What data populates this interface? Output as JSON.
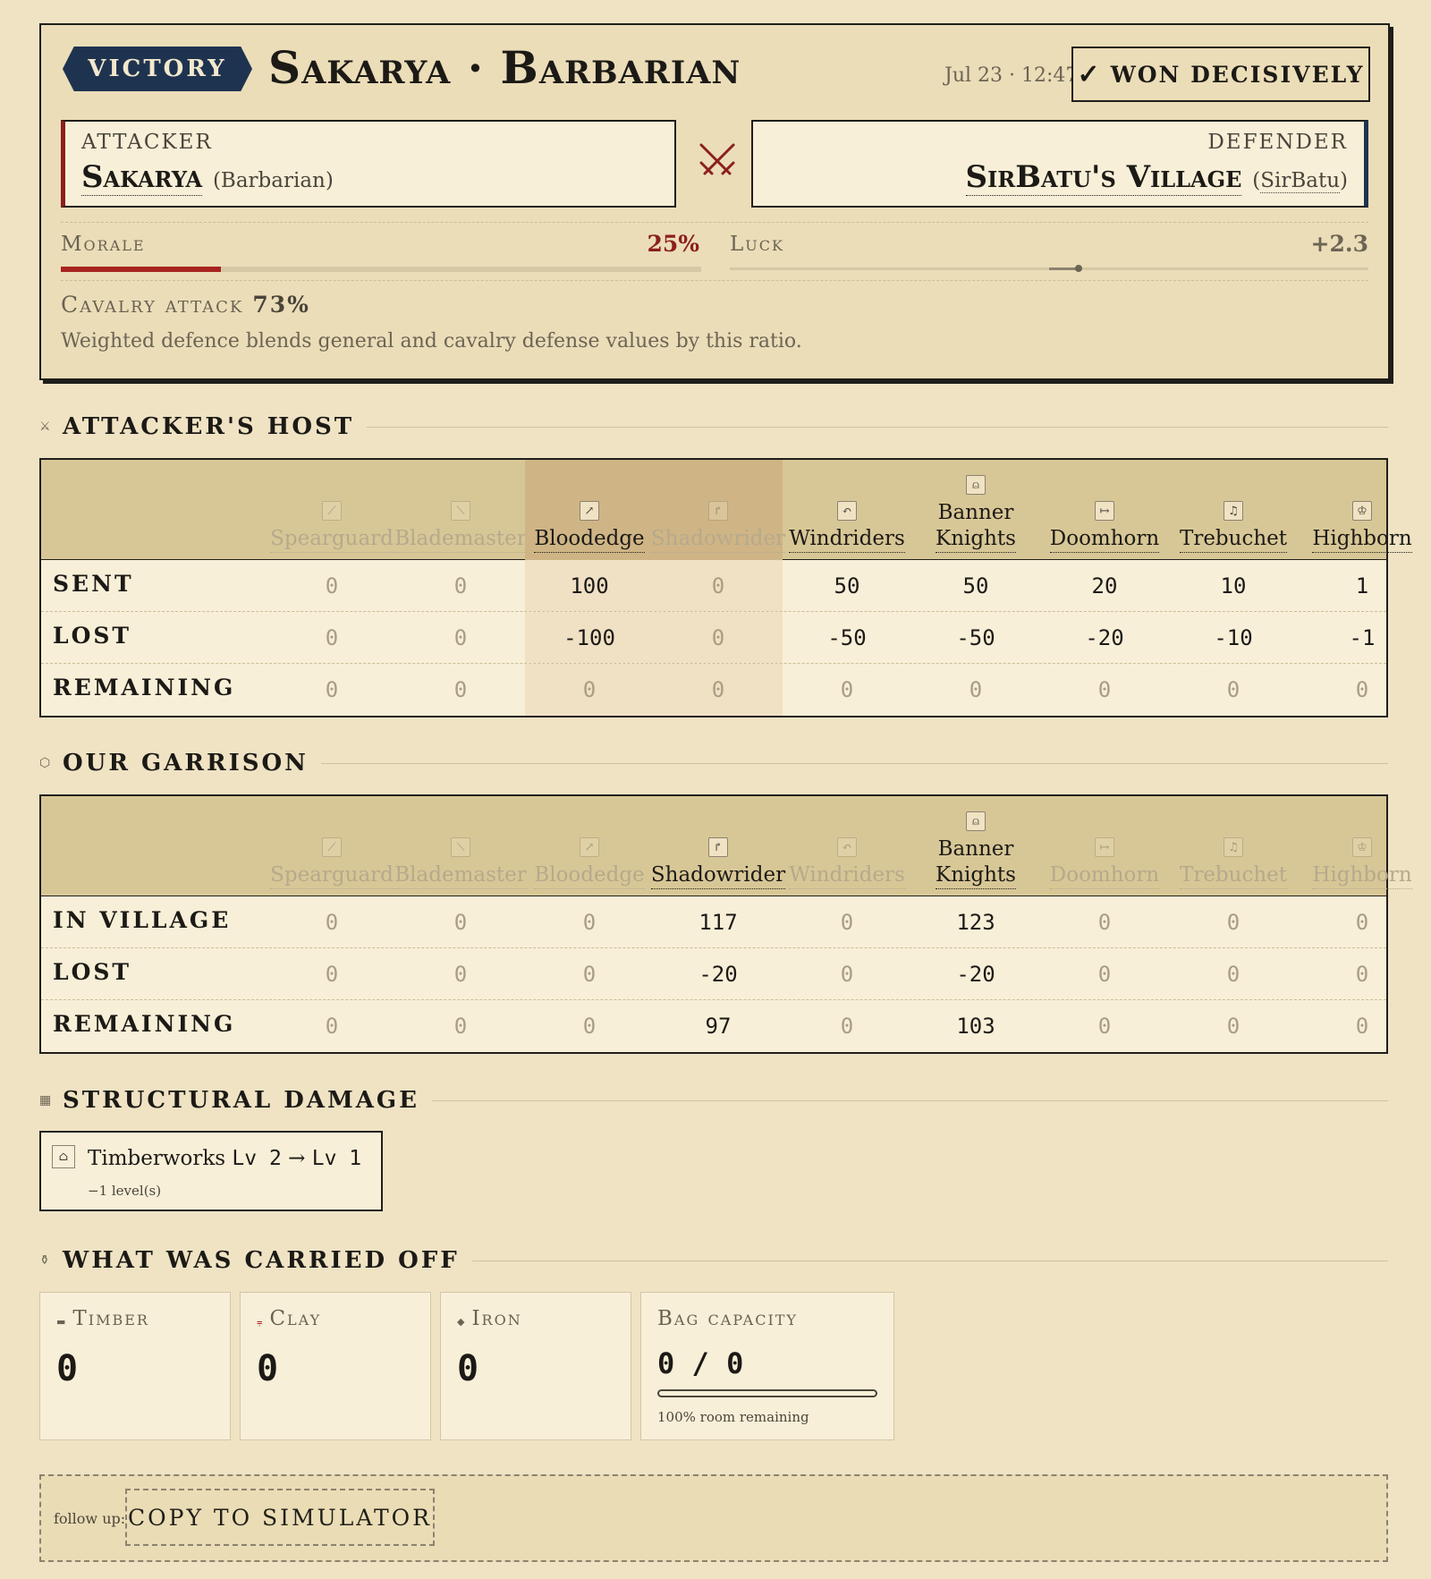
{
  "header": {
    "badge": "VICTORY",
    "title": "Sakarya · Barbarian",
    "timestamp": "Jul 23 · 12:47",
    "outcome_icon": "✓",
    "outcome": "WON DECISIVELY",
    "attacker": {
      "label": "ATTACKER",
      "name": "Sakarya",
      "sub": "(Barbarian)"
    },
    "defender": {
      "label": "DEFENDER",
      "name": "SirBatu's Village",
      "sub_open": "(",
      "sub_link": "SirBatu",
      "sub_close": ")"
    },
    "morale": {
      "label": "Morale",
      "value_text": "25%",
      "value": 0.25
    },
    "luck": {
      "label": "Luck",
      "value_text": "+2.3",
      "value": 2.3,
      "range": [
        -25,
        25
      ]
    },
    "cavalry": {
      "label": "Cavalry attack",
      "value_text": "73%"
    },
    "cavalry_note": "Weighted defence blends general and cavalry defense values by this ratio.",
    "colors": {
      "accent": "#8b1f1c",
      "navy": "#1e3350"
    }
  },
  "units": [
    {
      "name": "Spearguard",
      "icon": "spear-icon",
      "glyph": "⟋"
    },
    {
      "name": "Blademaster",
      "icon": "sword-icon",
      "glyph": "⟍"
    },
    {
      "name": "Bloodedge",
      "icon": "axe-icon",
      "glyph": "↗"
    },
    {
      "name": "Shadowrider",
      "icon": "rider-icon",
      "glyph": "↱"
    },
    {
      "name": "Windriders",
      "icon": "windrider-icon",
      "glyph": "↶"
    },
    {
      "name": "Banner Knights",
      "icon": "banner-icon",
      "glyph": "⍝"
    },
    {
      "name": "Doomhorn",
      "icon": "ram-icon",
      "glyph": "↦"
    },
    {
      "name": "Trebuchet",
      "icon": "trebuchet-icon",
      "glyph": "♫"
    },
    {
      "name": "Highborn",
      "icon": "crown-icon",
      "glyph": "♔"
    }
  ],
  "attacker_host": {
    "section_title": "ATTACKER'S HOST",
    "rows": [
      {
        "label": "SENT",
        "values": [
          "0",
          "0",
          "100",
          "0",
          "50",
          "50",
          "20",
          "10",
          "1"
        ]
      },
      {
        "label": "LOST",
        "values": [
          "0",
          "0",
          "-100",
          "0",
          "-50",
          "-50",
          "-20",
          "-10",
          "-1"
        ]
      },
      {
        "label": "REMAINING",
        "values": [
          "0",
          "0",
          "0",
          "0",
          "0",
          "0",
          "0",
          "0",
          "0"
        ]
      }
    ]
  },
  "garrison": {
    "section_title": "OUR GARRISON",
    "rows": [
      {
        "label": "IN VILLAGE",
        "values": [
          "0",
          "0",
          "0",
          "117",
          "0",
          "123",
          "0",
          "0",
          "0"
        ]
      },
      {
        "label": "LOST",
        "values": [
          "0",
          "0",
          "0",
          "-20",
          "0",
          "-20",
          "0",
          "0",
          "0"
        ]
      },
      {
        "label": "REMAINING",
        "values": [
          "0",
          "0",
          "0",
          "97",
          "0",
          "103",
          "0",
          "0",
          "0"
        ]
      }
    ]
  },
  "structural": {
    "section_title": "STRUCTURAL DAMAGE",
    "building": "Timberworks",
    "from_level": "Lv 2",
    "arrow": "→",
    "to_level": "Lv 1",
    "delta": "−1 level(s)"
  },
  "loot": {
    "section_title": "WHAT WAS CARRIED OFF",
    "timber": {
      "label": "Timber",
      "value": "0"
    },
    "clay": {
      "label": "Clay",
      "value": "0"
    },
    "iron": {
      "label": "Iron",
      "value": "0"
    },
    "bag": {
      "label": "Bag capacity",
      "value": "0 / 0",
      "note": "100% room remaining",
      "used_fraction": 0
    }
  },
  "follow_up": {
    "label": "follow up:",
    "button": "COPY TO SIMULATOR"
  }
}
